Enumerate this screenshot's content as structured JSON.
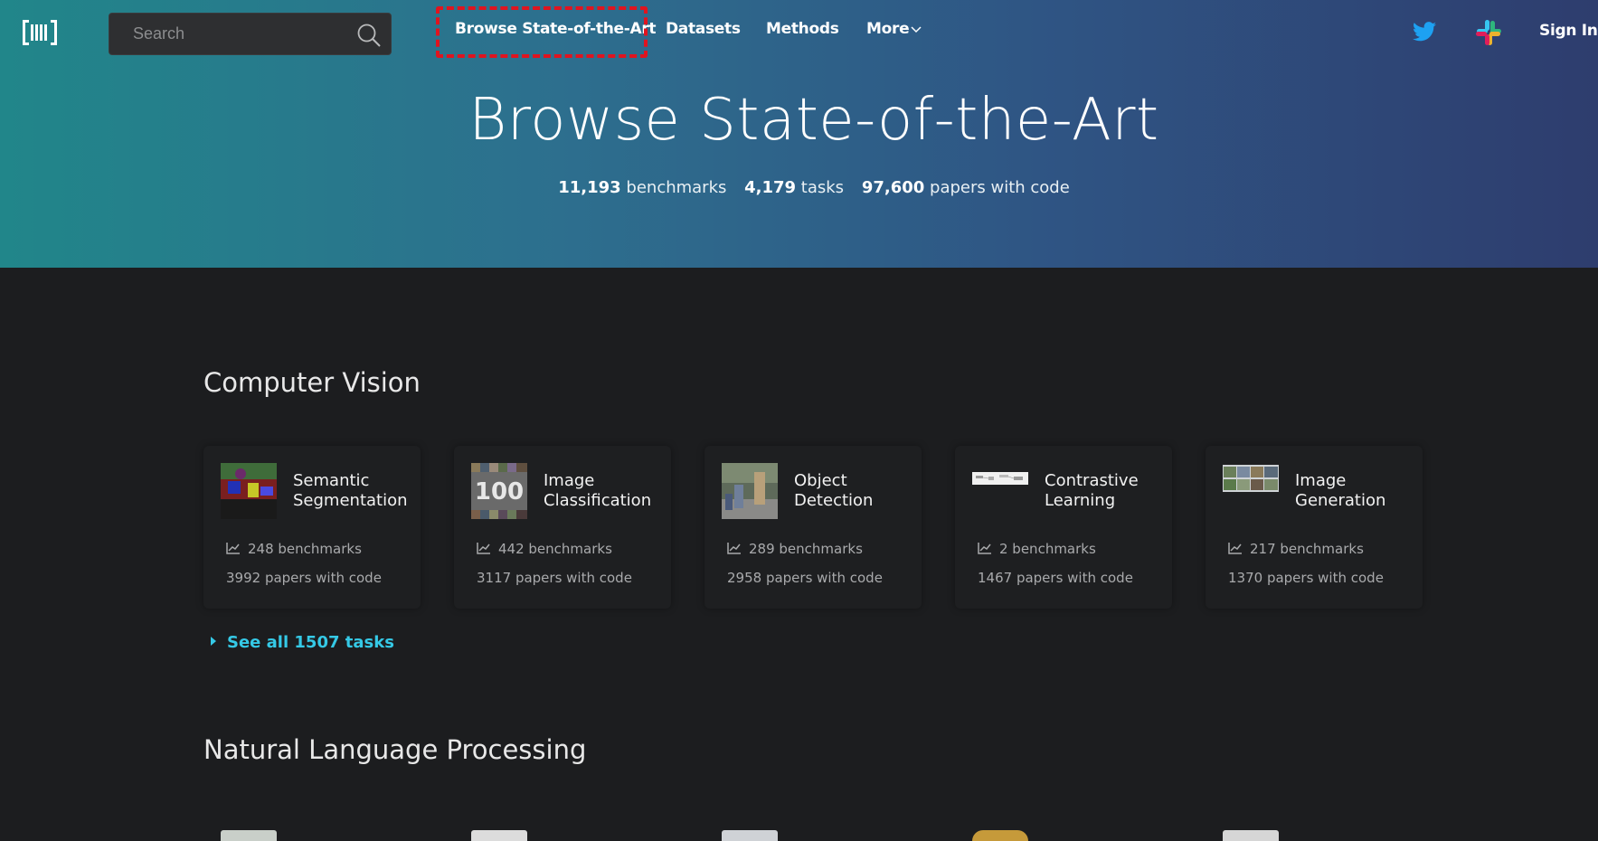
{
  "header": {
    "search_placeholder": "Search",
    "nav": {
      "sota": "Browse State-of-the-Art",
      "datasets": "Datasets",
      "methods": "Methods",
      "more": "More"
    },
    "signin": "Sign In",
    "icons": {
      "logo": "pwc-logo-icon",
      "search": "search-icon",
      "twitter": "twitter-icon",
      "slack": "slack-icon",
      "more_chevron": "chevron-down-icon"
    },
    "colors": {
      "gradient_start": "#21868a",
      "gradient_end": "#2e3d6e",
      "highlight": "#e0141f",
      "twitter": "#1da1f2"
    }
  },
  "hero": {
    "title": "Browse State-of-the-Art",
    "stats": [
      {
        "value": "11,193",
        "label": "benchmarks"
      },
      {
        "value": "4,179",
        "label": "tasks"
      },
      {
        "value": "97,600",
        "label": "papers with code"
      }
    ]
  },
  "sections": [
    {
      "title": "Computer Vision",
      "cards": [
        {
          "title": "Semantic Segmentation",
          "benchmarks": "248 benchmarks",
          "papers": "3992 papers with code"
        },
        {
          "title": "Image Classification",
          "benchmarks": "442 benchmarks",
          "papers": "3117 papers with code"
        },
        {
          "title": "Object Detection",
          "benchmarks": "289 benchmarks",
          "papers": "2958 papers with code"
        },
        {
          "title": "Contrastive Learning",
          "benchmarks": "2 benchmarks",
          "papers": "1467 papers with code"
        },
        {
          "title": "Image Generation",
          "benchmarks": "217 benchmarks",
          "papers": "1370 papers with code"
        }
      ],
      "see_all": "See all 1507 tasks"
    },
    {
      "title": "Natural Language Processing"
    }
  ],
  "accent_color": "#35c9e6"
}
